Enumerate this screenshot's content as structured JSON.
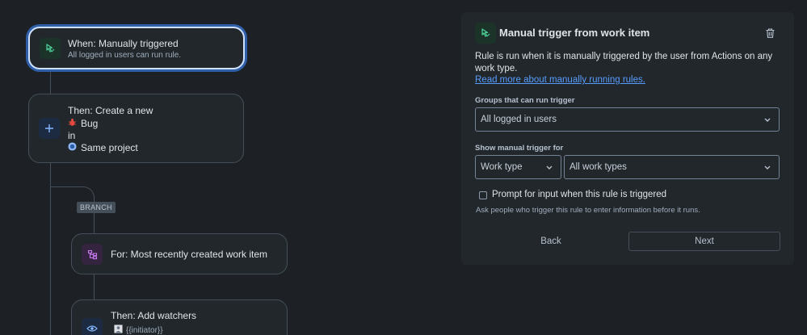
{
  "flow": {
    "trigger": {
      "title": "When: Manually triggered",
      "subtitle": "All logged in users can run rule.",
      "icon": "manual-trigger-icon"
    },
    "action_create": {
      "title": "Then: Create a new",
      "issue_type": "Bug",
      "connector": "in",
      "project": "Same project",
      "icon": "plus-icon"
    },
    "branch_tag": "BRANCH",
    "branch": {
      "title": "For: Most recently created work item",
      "icon": "branch-icon"
    },
    "action_watchers": {
      "title": "Then: Add watchers",
      "value": "{{initiator}}",
      "icon": "eye-icon"
    }
  },
  "panel": {
    "title": "Manual trigger from work item",
    "description": "Rule is run when it is manually triggered by the user from Actions on any work type.",
    "link": "Read more about manually running rules.",
    "groups_label": "Groups that can run trigger",
    "groups_value": "All logged in users",
    "show_label": "Show manual trigger for",
    "show_type_value": "Work type",
    "show_scope_value": "All work types",
    "prompt_label": "Prompt for input when this rule is triggered",
    "prompt_helper": "Ask people who trigger this rule to enter information before it runs.",
    "back_label": "Back",
    "next_label": "Next"
  },
  "colors": {
    "accent": "#579dff",
    "trigger_green": "#4bce97",
    "bug_red": "#e2483d",
    "branch_purple": "#c97cf4"
  }
}
